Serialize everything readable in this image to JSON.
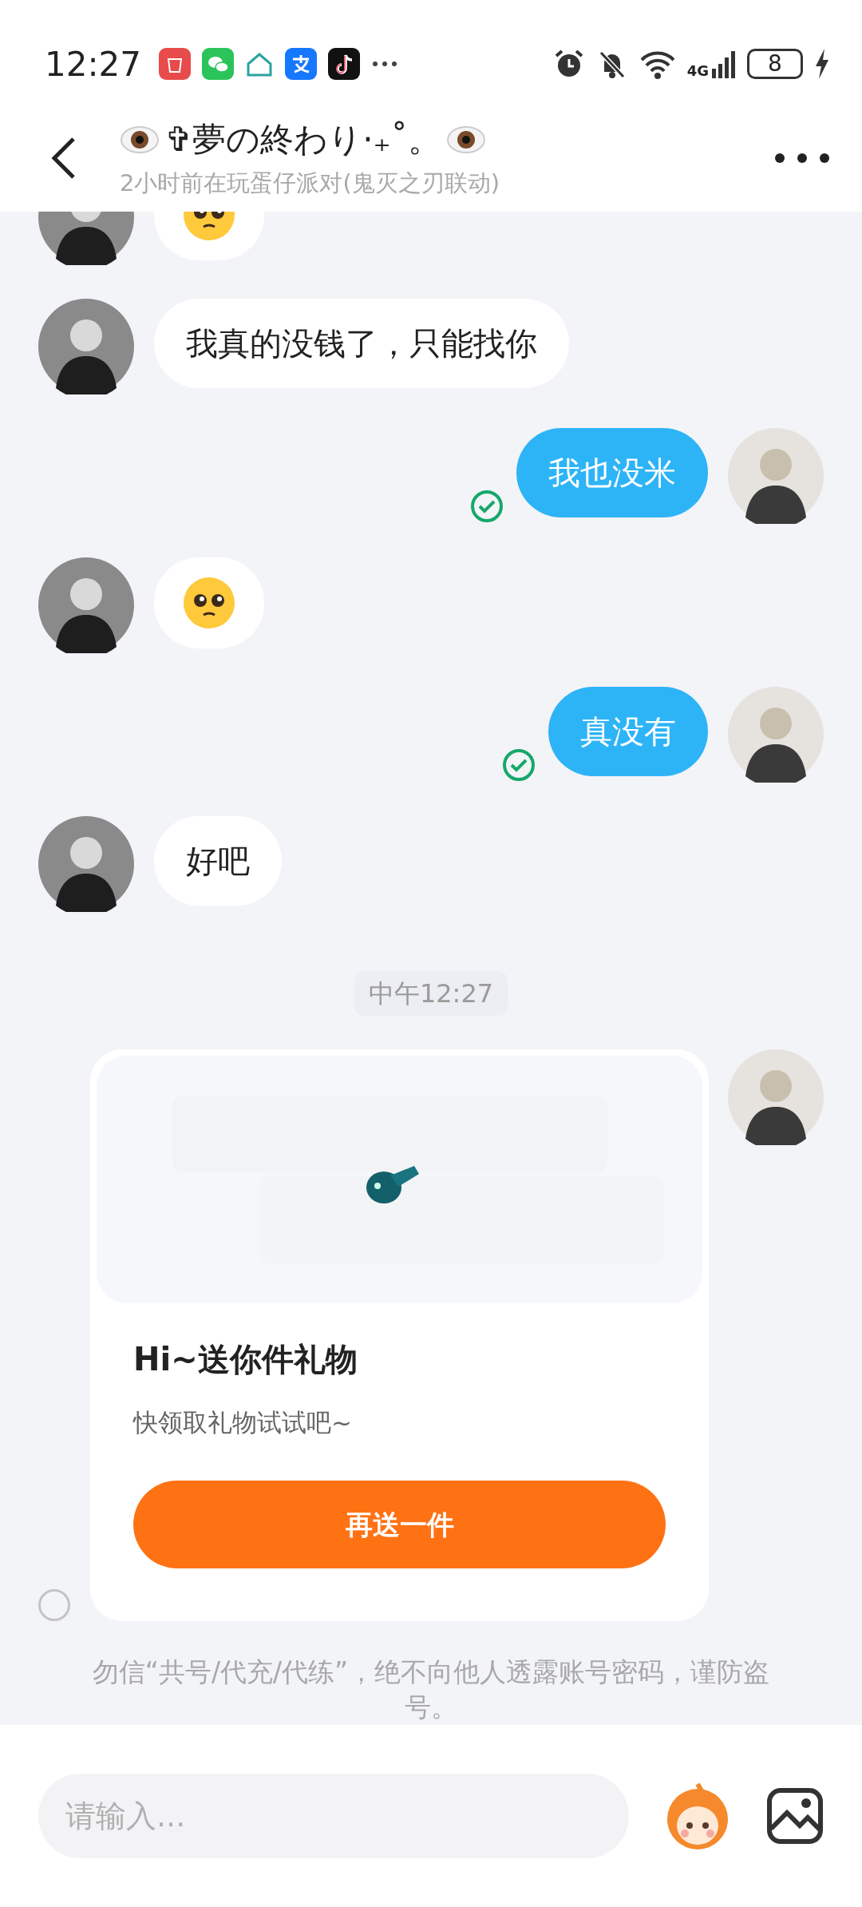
{
  "status_bar": {
    "time": "12:27",
    "network": "4G",
    "battery": "8"
  },
  "header": {
    "title": "✞夢の終わり·₊˚。",
    "subtitle": "2小时前在玩蛋仔派对(鬼灭之刃联动)"
  },
  "messages": [
    {
      "kind": "emoji",
      "outgoing": false
    },
    {
      "kind": "text",
      "outgoing": false,
      "text": "我真的没钱了，只能找你"
    },
    {
      "kind": "text",
      "outgoing": true,
      "text": "我也没米",
      "read": true
    },
    {
      "kind": "emoji",
      "outgoing": false
    },
    {
      "kind": "text",
      "outgoing": true,
      "text": "真没有",
      "read": true
    },
    {
      "kind": "text",
      "outgoing": false,
      "text": "好吧"
    },
    {
      "kind": "time",
      "text": "中午12:27"
    },
    {
      "kind": "gift",
      "outgoing": true,
      "title": "Hi~送你件礼物",
      "description": "快领取礼物试试吧~",
      "button": "再送一件",
      "selected": false
    }
  ],
  "notice": "勿信“共号/代充/代练”，绝不向他人透露账号密码，谨防盗号。",
  "input": {
    "placeholder": "请输入..."
  }
}
